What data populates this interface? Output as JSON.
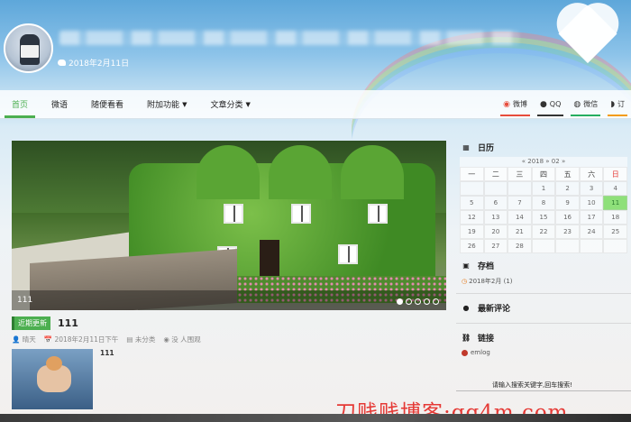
{
  "header": {
    "date": "2018年2月11日"
  },
  "nav": {
    "items": [
      {
        "label": "首页",
        "active": true
      },
      {
        "label": "微语"
      },
      {
        "label": "随便看看"
      },
      {
        "label": "附加功能",
        "dropdown": true
      },
      {
        "label": "文章分类",
        "dropdown": true
      }
    ],
    "social": [
      {
        "label": "微博",
        "icon": "weibo-icon"
      },
      {
        "label": "QQ",
        "icon": "qq-icon"
      },
      {
        "label": "微信",
        "icon": "wechat-icon"
      },
      {
        "label": "订",
        "icon": "rss-icon"
      }
    ]
  },
  "slider": {
    "caption": "111",
    "dots": 5,
    "active_dot": 1
  },
  "post": {
    "badge": "近期更新",
    "title": "111",
    "meta": {
      "author": "晴天",
      "datetime": "2018年2月11日下午",
      "category": "未分类",
      "views": "没 人围观"
    },
    "excerpt": "111"
  },
  "sidebar": {
    "calendar": {
      "title": "日历",
      "month_label": "« 2018 » 02 »",
      "weekdays": [
        "一",
        "二",
        "三",
        "四",
        "五",
        "六",
        "日"
      ],
      "days": [
        [
          "",
          "",
          "",
          "1",
          "2",
          "3",
          "4"
        ],
        [
          "5",
          "6",
          "7",
          "8",
          "9",
          "10",
          "11"
        ],
        [
          "12",
          "13",
          "14",
          "15",
          "16",
          "17",
          "18"
        ],
        [
          "19",
          "20",
          "21",
          "22",
          "23",
          "24",
          "25"
        ],
        [
          "26",
          "27",
          "28",
          "",
          "",
          "",
          ""
        ]
      ],
      "today": "11"
    },
    "archive": {
      "title": "存档",
      "link": "2018年2月 (1)"
    },
    "comments": {
      "title": "最新评论"
    },
    "links": {
      "title": "链接",
      "items": [
        "emlog"
      ]
    },
    "search_text": "请输入搜索关键字,回车搜索!"
  },
  "watermark": "刀贱贱博客:qq4m.com"
}
